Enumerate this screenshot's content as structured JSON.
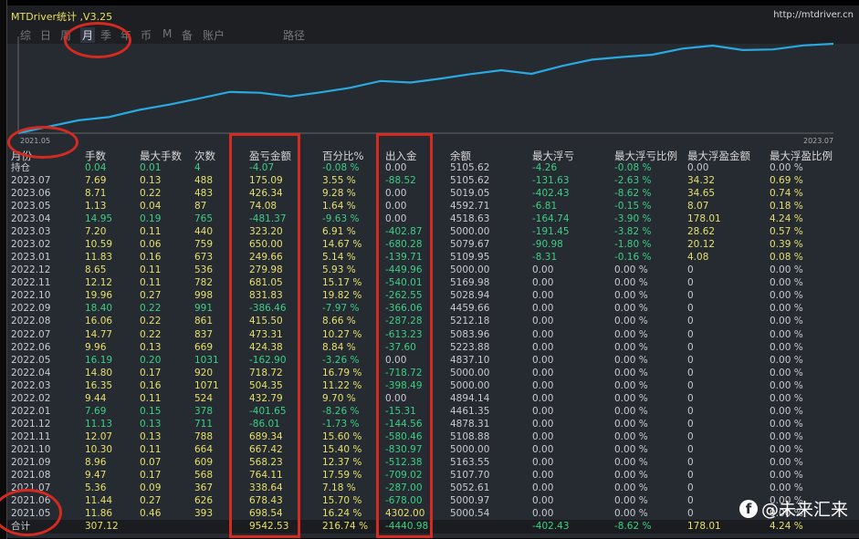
{
  "app": {
    "title": "MTDriver统计 ,V3.25",
    "url": "http://mtdriver.cn"
  },
  "tabs": [
    "综",
    "日",
    "周",
    "月",
    "季",
    "年",
    "币",
    "M",
    "备",
    "账户",
    "路径"
  ],
  "active_tab": "月",
  "chart": {
    "start_label": "2021.05",
    "end_label": "2023.07",
    "line_color": "#2aa8e0"
  },
  "table": {
    "headers": [
      "月份",
      "手数",
      "最大手数",
      "次数",
      "盈亏金额",
      "百分比%",
      "出入金",
      "余额",
      "最大浮亏",
      "最大浮亏比例",
      "最大浮盈金额",
      "最大浮盈比例"
    ],
    "rows": [
      [
        "持仓",
        "0.04",
        "0.01",
        "4",
        "-4.07",
        "-0.08 %",
        "0.00",
        "5105.62",
        "-4.26",
        "-0.08 %",
        "0.00",
        "0.00 %"
      ],
      [
        "2023.07",
        "7.69",
        "0.13",
        "488",
        "175.09",
        "3.55 %",
        "-88.52",
        "5105.62",
        "-131.63",
        "-2.63 %",
        "34.32",
        "0.69 %"
      ],
      [
        "2023.06",
        "8.71",
        "0.22",
        "483",
        "426.34",
        "9.28 %",
        "0.00",
        "5019.05",
        "-402.43",
        "-8.62 %",
        "34.65",
        "0.74 %"
      ],
      [
        "2023.05",
        "1.13",
        "0.04",
        "87",
        "74.08",
        "1.64 %",
        "0.00",
        "4592.71",
        "-6.81",
        "-0.15 %",
        "8.07",
        "0.18 %"
      ],
      [
        "2023.04",
        "14.95",
        "0.19",
        "765",
        "-481.37",
        "-9.63 %",
        "0.00",
        "4518.63",
        "-164.74",
        "-3.90 %",
        "178.01",
        "4.24 %"
      ],
      [
        "2023.03",
        "7.20",
        "0.11",
        "440",
        "323.20",
        "6.91 %",
        "-402.87",
        "5000.00",
        "-191.45",
        "-3.82 %",
        "28.62",
        "0.57 %"
      ],
      [
        "2023.02",
        "10.59",
        "0.06",
        "759",
        "650.00",
        "14.67 %",
        "-680.28",
        "5079.67",
        "-90.98",
        "-1.80 %",
        "20.12",
        "0.39 %"
      ],
      [
        "2023.01",
        "11.83",
        "0.16",
        "673",
        "249.66",
        "5.14 %",
        "-139.71",
        "5109.95",
        "-8.31",
        "-0.16 %",
        "4.08",
        "0.08 %"
      ],
      [
        "2022.12",
        "8.65",
        "0.11",
        "536",
        "279.98",
        "5.93 %",
        "-449.96",
        "5000.00",
        "0.00",
        "0.00 %",
        "0",
        "0.00 %"
      ],
      [
        "2022.11",
        "12.12",
        "0.11",
        "782",
        "681.05",
        "15.17 %",
        "-540.01",
        "5169.98",
        "0.00",
        "0.00 %",
        "0",
        "0.00 %"
      ],
      [
        "2022.10",
        "19.96",
        "0.27",
        "998",
        "831.83",
        "19.82 %",
        "-262.55",
        "5028.94",
        "0.00",
        "0.00 %",
        "0",
        "0.00 %"
      ],
      [
        "2022.09",
        "18.40",
        "0.22",
        "991",
        "-386.46",
        "-7.97 %",
        "-366.06",
        "4459.66",
        "0.00",
        "0.00 %",
        "0",
        "0.00 %"
      ],
      [
        "2022.08",
        "16.06",
        "0.22",
        "861",
        "415.50",
        "8.66 %",
        "-287.28",
        "5212.18",
        "0.00",
        "0.00 %",
        "0",
        "0.00 %"
      ],
      [
        "2022.07",
        "14.77",
        "0.22",
        "837",
        "473.31",
        "10.27 %",
        "-613.23",
        "5083.96",
        "0.00",
        "0.00 %",
        "0",
        "0.00 %"
      ],
      [
        "2022.06",
        "9.96",
        "0.13",
        "669",
        "424.38",
        "8.84 %",
        "-37.60",
        "5223.88",
        "0.00",
        "0.00 %",
        "0",
        "0.00 %"
      ],
      [
        "2022.05",
        "16.19",
        "0.20",
        "1031",
        "-162.90",
        "-3.26 %",
        "0.00",
        "4837.10",
        "0.00",
        "0.00 %",
        "0",
        "0.00 %"
      ],
      [
        "2022.04",
        "14.80",
        "0.17",
        "920",
        "718.72",
        "16.79 %",
        "-718.72",
        "5000.00",
        "0.00",
        "0.00 %",
        "0",
        "0.00 %"
      ],
      [
        "2022.03",
        "16.35",
        "0.16",
        "1071",
        "504.35",
        "11.22 %",
        "-398.49",
        "5000.00",
        "0.00",
        "0.00 %",
        "0",
        "0.00 %"
      ],
      [
        "2022.02",
        "9.44",
        "0.11",
        "524",
        "432.79",
        "9.70 %",
        "0.00",
        "4894.14",
        "0.00",
        "0.00 %",
        "0",
        "0.00 %"
      ],
      [
        "2022.01",
        "7.69",
        "0.15",
        "378",
        "-401.65",
        "-8.26 %",
        "-15.31",
        "4461.35",
        "0.00",
        "0.00 %",
        "0",
        "0.00 %"
      ],
      [
        "2021.12",
        "11.13",
        "0.13",
        "711",
        "-86.01",
        "-1.73 %",
        "-144.56",
        "4878.31",
        "0.00",
        "0.00 %",
        "0",
        "0.00 %"
      ],
      [
        "2021.11",
        "12.07",
        "0.13",
        "788",
        "689.34",
        "15.60 %",
        "-580.46",
        "5108.88",
        "0.00",
        "0.00 %",
        "0",
        "0.00 %"
      ],
      [
        "2021.10",
        "10.30",
        "0.11",
        "664",
        "667.42",
        "15.40 %",
        "-830.97",
        "5000.00",
        "0.00",
        "0.00 %",
        "0",
        "0.00 %"
      ],
      [
        "2021.09",
        "8.96",
        "0.07",
        "609",
        "568.23",
        "12.37 %",
        "-512.38",
        "5163.55",
        "0.00",
        "0.00 %",
        "0",
        "0.00 %"
      ],
      [
        "2021.08",
        "9.47",
        "0.17",
        "568",
        "764.11",
        "17.59 %",
        "-709.02",
        "5107.70",
        "0.00",
        "0.00 %",
        "0",
        "0.00 %"
      ],
      [
        "2021.07",
        "5.36",
        "0.09",
        "367",
        "338.64",
        "7.18 %",
        "-287.00",
        "5052.61",
        "0.00",
        "0.00 %",
        "0",
        "0.00 %"
      ],
      [
        "2021.06",
        "11.44",
        "0.27",
        "626",
        "678.43",
        "15.70 %",
        "-678.00",
        "5000.97",
        "0.00",
        "0.00 %",
        "0",
        "0.00 %"
      ],
      [
        "2021.05",
        "11.86",
        "0.46",
        "393",
        "698.54",
        "16.24 %",
        "4302.00",
        "5000.54",
        "0.00",
        "0.00 %",
        "0",
        "0.00 %"
      ]
    ],
    "total": [
      "合计",
      "307.12",
      "",
      "",
      "9542.53",
      "216.74 %",
      "-4440.98",
      "",
      "-402.43",
      "-8.62 %",
      "178.01",
      "4.24 %"
    ]
  },
  "watermark": "@未来汇来",
  "colors": {
    "positive": "#e4e06c",
    "negative": "#3ccf86",
    "neutral": "#c8cad0",
    "annotation": "#d42a20"
  }
}
